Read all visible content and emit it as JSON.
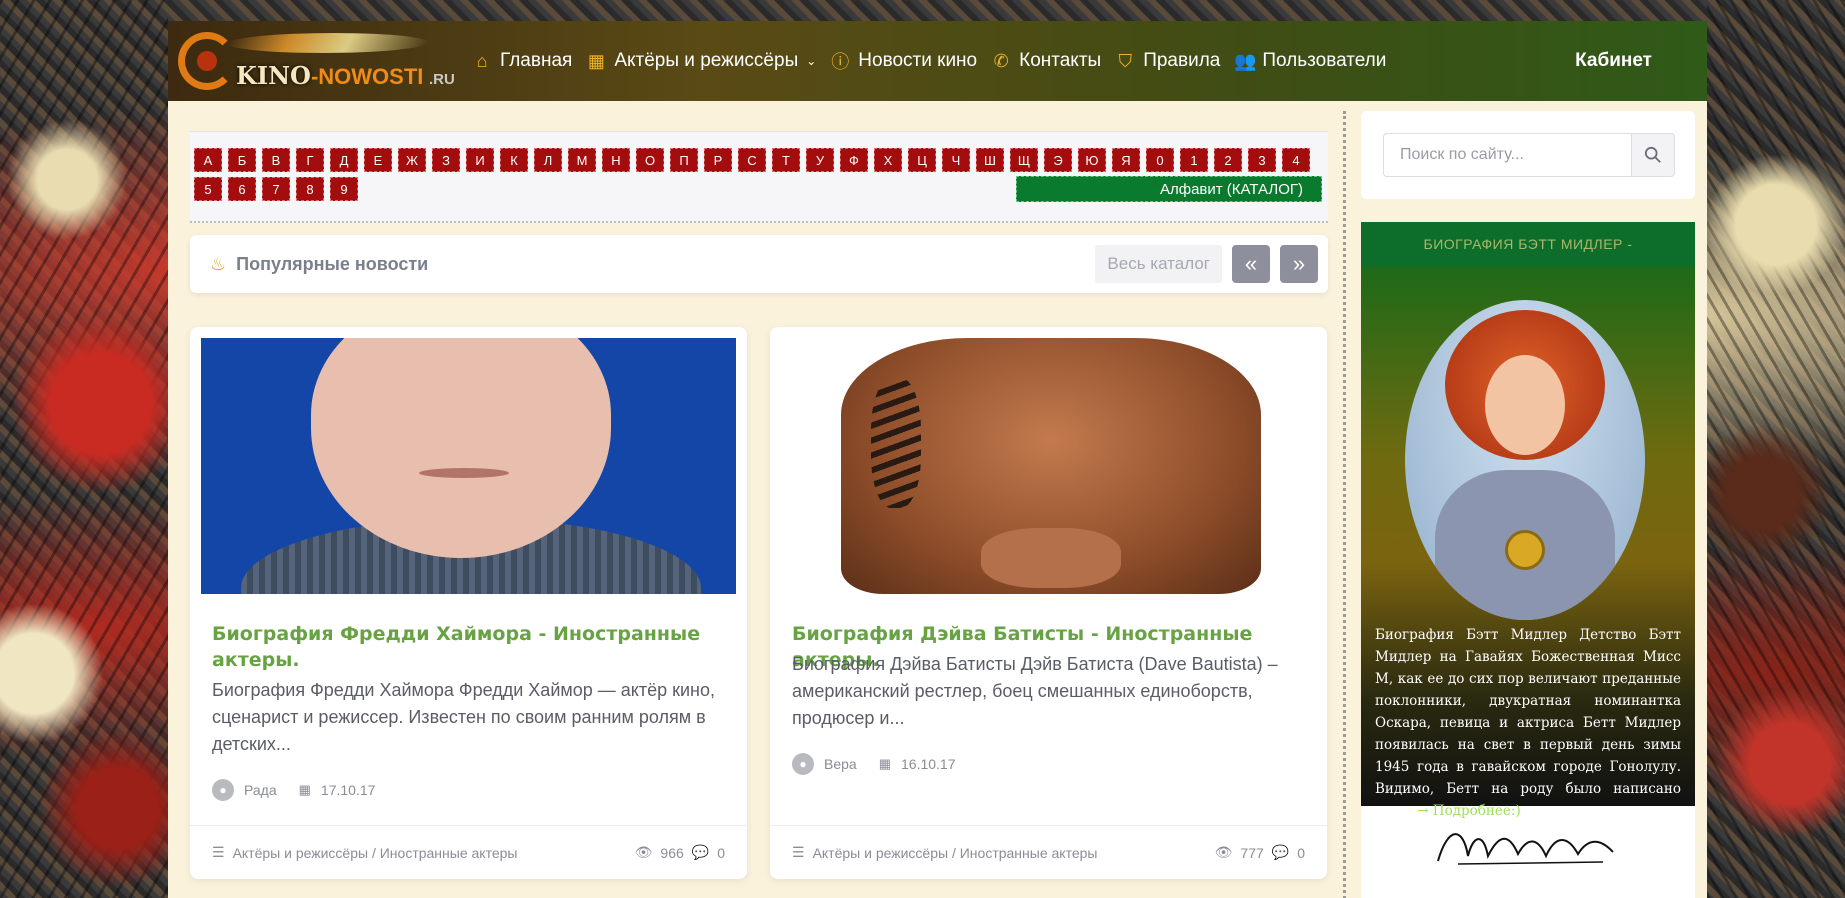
{
  "header": {
    "logo": {
      "kino": "KINO",
      "nowosti": "-NOWOSTI",
      "ru": ".RU"
    },
    "nav": [
      {
        "label": "Главная",
        "icon": "home-icon"
      },
      {
        "label": "Актёры и режиссёры",
        "icon": "grid-icon",
        "has_dropdown": true
      },
      {
        "label": "Новости кино",
        "icon": "info-icon"
      },
      {
        "label": "Контакты",
        "icon": "phone-icon"
      },
      {
        "label": "Правила",
        "icon": "shield-check-icon"
      },
      {
        "label": "Пользователи",
        "icon": "users-icon"
      }
    ],
    "cabinet": "Кабинет"
  },
  "alphabet": {
    "row1": [
      "А",
      "Б",
      "В",
      "Г",
      "Д",
      "Е",
      "Ж",
      "З",
      "И",
      "К",
      "Л",
      "М",
      "Н",
      "О",
      "П",
      "Р",
      "С",
      "Т",
      "У",
      "Ф",
      "Х",
      "Ц",
      "Ч",
      "Ш",
      "Щ",
      "Э",
      "Ю",
      "Я",
      "0",
      "1",
      "2",
      "3",
      "4"
    ],
    "row2": [
      "5",
      "6",
      "7",
      "8",
      "9"
    ],
    "catalog_label": "Алфавит (КАТАЛОГ)"
  },
  "popular": {
    "title": "Популярные новости",
    "all_catalog": "Весь каталог",
    "prev": "«",
    "next": "»"
  },
  "cards": [
    {
      "title": "Биография Фредди Хаймора - Иностранные актеры.",
      "text": "Биография Фредди Хаймора Фредди Хаймор — актёр кино, сценарист и режиссер. Известен по своим ранним ролям в детских...",
      "author": "Рада",
      "date": "17.10.17",
      "category": "Актёры и режиссёры / Иностранные актеры",
      "views": "966",
      "comments": "0"
    },
    {
      "title": "Биография Дэйва Батисты - Иностранные актеры.",
      "text": "Биография Дэйва Батисты Дэйв Батиста (Dave Bautista) – американский рестлер, боец смешанных единоборств, продюсер и...",
      "author": "Вера",
      "date": "16.10.17",
      "category": "Актёры и режиссёры / Иностранные актеры",
      "views": "777",
      "comments": "0"
    }
  ],
  "sidebar": {
    "search_placeholder": "Поиск по сайту...",
    "bio_heading": "БИОГРАФИЯ БЭТТ МИДЛЕР -",
    "bio_text": "Биография Бэтт Мидлер Детство Бэтт Мидлер на Гавайях Божественная Мисс М, как ее до сих пор величают преданные поклонники, двукратная номинантка Оскара, певица и актриса Бетт Мидлер появилась на свет в первый день зимы 1945 года в гавайском городе Гонолулу. Видимо, Бетт на роду было написано стать",
    "more_link": "→ Подробнее:)"
  },
  "colors": {
    "letter_bg": "#a30d0d",
    "catalog_bg": "#0a7a2f",
    "title_green": "#67a343",
    "nav_icon": "#f2b32a"
  }
}
